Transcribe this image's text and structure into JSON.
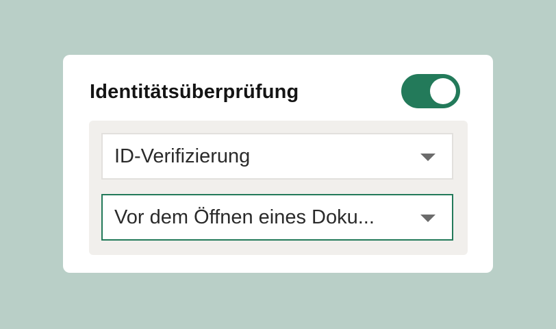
{
  "identity_check": {
    "title": "Identitätsüberprüfung",
    "enabled": true,
    "method_select": {
      "value": "ID-Verifizierung",
      "icon": "chevron-down-icon"
    },
    "timing_select": {
      "value": "Vor dem Öffnen eines Doku...",
      "icon": "chevron-down-icon"
    }
  },
  "colors": {
    "background": "#b9cfc7",
    "card": "#ffffff",
    "panel": "#f1efec",
    "accent": "#237a5a",
    "select_border": "#e2e0dd"
  }
}
